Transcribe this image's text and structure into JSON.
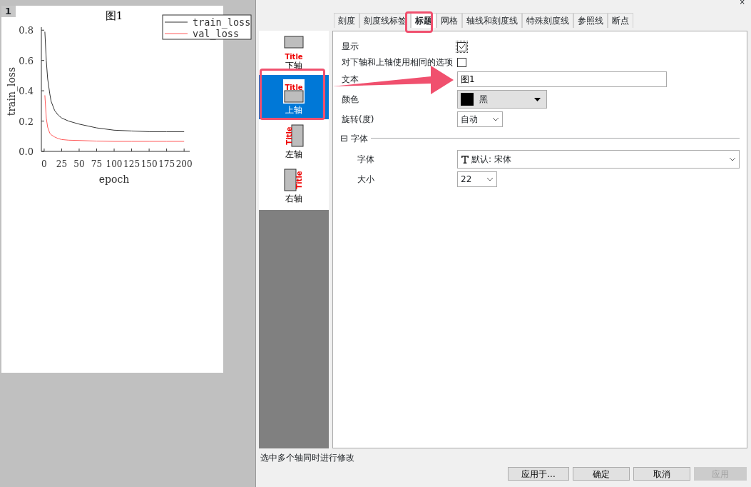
{
  "plot_window": {
    "number": "1",
    "chart_data": {
      "type": "line",
      "title": "图1",
      "xlabel": "epoch",
      "ylabel": "train_loss",
      "x": [
        1,
        3,
        5,
        8,
        10,
        15,
        20,
        25,
        35,
        50,
        75,
        100,
        125,
        150,
        175,
        200
      ],
      "series": [
        {
          "name": "train_loss",
          "color": "#333333",
          "values": [
            0.79,
            0.6,
            0.48,
            0.38,
            0.33,
            0.27,
            0.24,
            0.22,
            0.2,
            0.18,
            0.155,
            0.14,
            0.135,
            0.13,
            0.13,
            0.13
          ]
        },
        {
          "name": "val_loss",
          "color": "#ff5a5a",
          "values": [
            0.37,
            0.22,
            0.16,
            0.12,
            0.11,
            0.095,
            0.085,
            0.078,
            0.074,
            0.072,
            0.068,
            0.066,
            0.066,
            0.066,
            0.066,
            0.066
          ]
        }
      ],
      "xlim": [
        -4,
        208
      ],
      "ylim": [
        0,
        0.82
      ],
      "legend": "upper right",
      "xticks": [
        0,
        25,
        50,
        75,
        100,
        125,
        150,
        175,
        200
      ],
      "yticks": [
        {
          "value": 0,
          "label": "0.0"
        },
        {
          "value": 0.2,
          "label": "0.2"
        },
        {
          "value": 0.4,
          "label": "0.4"
        },
        {
          "value": 0.6,
          "label": "0.6"
        },
        {
          "value": 0.8,
          "label": "0.8"
        }
      ]
    }
  },
  "dialog": {
    "close": "×",
    "tabs": [
      {
        "label": "刻度",
        "selected": false
      },
      {
        "label": "刻度线标签",
        "selected": false
      },
      {
        "label": "标题",
        "selected": true
      },
      {
        "label": "网格",
        "selected": false
      },
      {
        "label": "轴线和刻度线",
        "selected": false
      },
      {
        "label": "特殊刻度线",
        "selected": false
      },
      {
        "label": "参照线",
        "selected": false
      },
      {
        "label": "断点",
        "selected": false
      }
    ],
    "axes": [
      {
        "label": "下轴",
        "kind": "bottom",
        "icon_caption": "Title",
        "selected": false
      },
      {
        "label": "上轴",
        "kind": "top",
        "icon_caption": "Title",
        "selected": true
      },
      {
        "label": "左轴",
        "kind": "left",
        "icon_caption": "Title",
        "selected": false
      },
      {
        "label": "右轴",
        "kind": "right",
        "icon_caption": "Title",
        "selected": false
      }
    ],
    "form": {
      "show": {
        "label": "显示",
        "checked": true
      },
      "same_options": {
        "label": "对下轴和上轴使用相同的选项",
        "checked": false
      },
      "text": {
        "label": "文本",
        "value": "图1"
      },
      "color": {
        "label": "颜色",
        "value": "黑"
      },
      "rotation": {
        "label": "旋转(度)",
        "value": "自动"
      },
      "font_group": {
        "toggle": "⊟",
        "label": "字体",
        "expanded": true
      },
      "font": {
        "label": "字体",
        "value": "默认: 宋体"
      },
      "size": {
        "label": "大小",
        "value": "22"
      }
    },
    "status": "选中多个轴同时进行修改",
    "buttons": [
      {
        "label": "应用于...",
        "disabled": false
      },
      {
        "label": "确定",
        "disabled": false
      },
      {
        "label": "取消",
        "disabled": false
      },
      {
        "label": "应用",
        "disabled": true
      }
    ]
  }
}
